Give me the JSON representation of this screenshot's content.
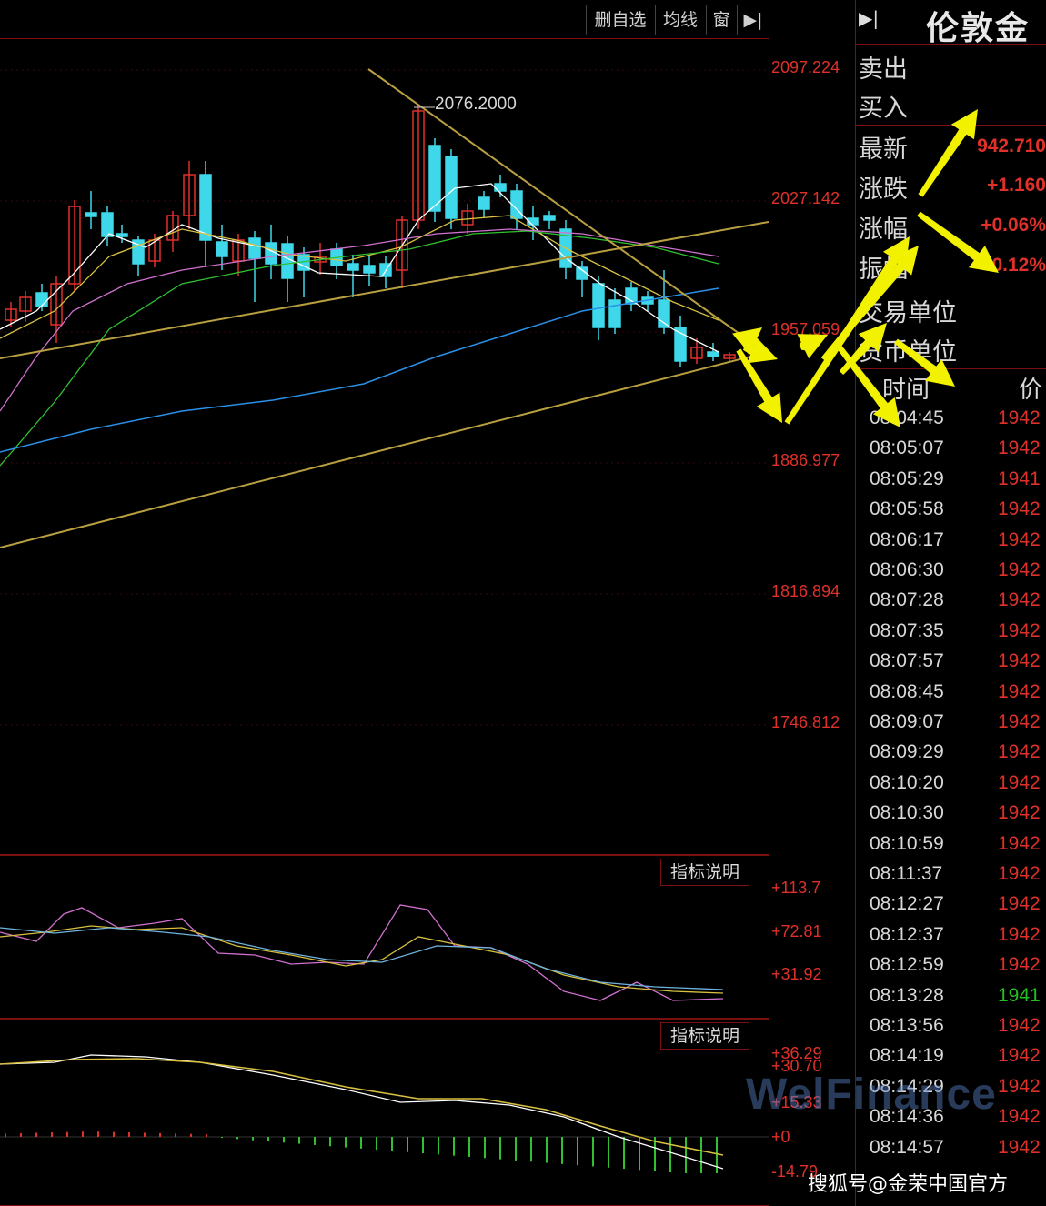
{
  "toolbar": {
    "delete_watchlist": "删自选",
    "ma_line": "均线",
    "window": "窗",
    "arrow": "▶|"
  },
  "quote": {
    "collapse": "▶|",
    "title": "伦敦金",
    "sell_label": "卖出",
    "buy_label": "买入",
    "latest_label": "最新",
    "latest_value": "942.710",
    "change_label": "涨跌",
    "change_value": "+1.160",
    "pct_label": "涨幅",
    "pct_value": "+0.06%",
    "amp_label": "振幅",
    "amp_value": "+0.12%",
    "trade_unit_label": "交易单位",
    "currency_unit_label": "货币单位"
  },
  "ticks": {
    "time_header": "时间",
    "price_header": "价",
    "rows": [
      {
        "time": "08:04:45",
        "price": "1942",
        "color": "red"
      },
      {
        "time": "08:05:07",
        "price": "1942",
        "color": "red"
      },
      {
        "time": "08:05:29",
        "price": "1941",
        "color": "red"
      },
      {
        "time": "08:05:58",
        "price": "1942",
        "color": "red"
      },
      {
        "time": "08:06:17",
        "price": "1942",
        "color": "red"
      },
      {
        "time": "08:06:30",
        "price": "1942",
        "color": "red"
      },
      {
        "time": "08:07:28",
        "price": "1942",
        "color": "red"
      },
      {
        "time": "08:07:35",
        "price": "1942",
        "color": "red"
      },
      {
        "time": "08:07:57",
        "price": "1942",
        "color": "red"
      },
      {
        "time": "08:08:45",
        "price": "1942",
        "color": "red"
      },
      {
        "time": "08:09:07",
        "price": "1942",
        "color": "red"
      },
      {
        "time": "08:09:29",
        "price": "1942",
        "color": "red"
      },
      {
        "time": "08:10:20",
        "price": "1942",
        "color": "red"
      },
      {
        "time": "08:10:30",
        "price": "1942",
        "color": "red"
      },
      {
        "time": "08:10:59",
        "price": "1942",
        "color": "red"
      },
      {
        "time": "08:11:37",
        "price": "1942",
        "color": "red"
      },
      {
        "time": "08:12:27",
        "price": "1942",
        "color": "red"
      },
      {
        "time": "08:12:37",
        "price": "1942",
        "color": "red"
      },
      {
        "time": "08:12:59",
        "price": "1942",
        "color": "red"
      },
      {
        "time": "08:13:28",
        "price": "1941",
        "color": "green"
      },
      {
        "time": "08:13:56",
        "price": "1942",
        "color": "red"
      },
      {
        "time": "08:14:19",
        "price": "1942",
        "color": "red"
      },
      {
        "time": "08:14:29",
        "price": "1942",
        "color": "red"
      },
      {
        "time": "08:14:36",
        "price": "1942",
        "color": "red"
      },
      {
        "time": "08:14:57",
        "price": "1942",
        "color": "red"
      }
    ]
  },
  "main_chart": {
    "axis_labels": [
      "2097.224",
      "2027.142",
      "1957.059",
      "1886.977",
      "1816.894",
      "1746.812"
    ],
    "high_annotation": "2076.2000",
    "colors": {
      "up": "#e0302a",
      "down": "#3fd8ea",
      "trend": "#b8a040",
      "ma5": "#ffffff",
      "ma10": "#d8c040",
      "ma20": "#30c030",
      "ma60": "#d070d0",
      "ma120": "#2a90e8"
    }
  },
  "indicator1": {
    "button": "指标说明",
    "axis_labels": [
      "+113.7",
      "+72.81",
      "+31.92"
    ]
  },
  "indicator2": {
    "button": "指标说明",
    "axis_labels": [
      "+36.29",
      "+30.70",
      "+15.33",
      "+0",
      "-14.79"
    ]
  },
  "watermark": "WelFinance",
  "source": "搜狐号@金荣中国官方"
}
